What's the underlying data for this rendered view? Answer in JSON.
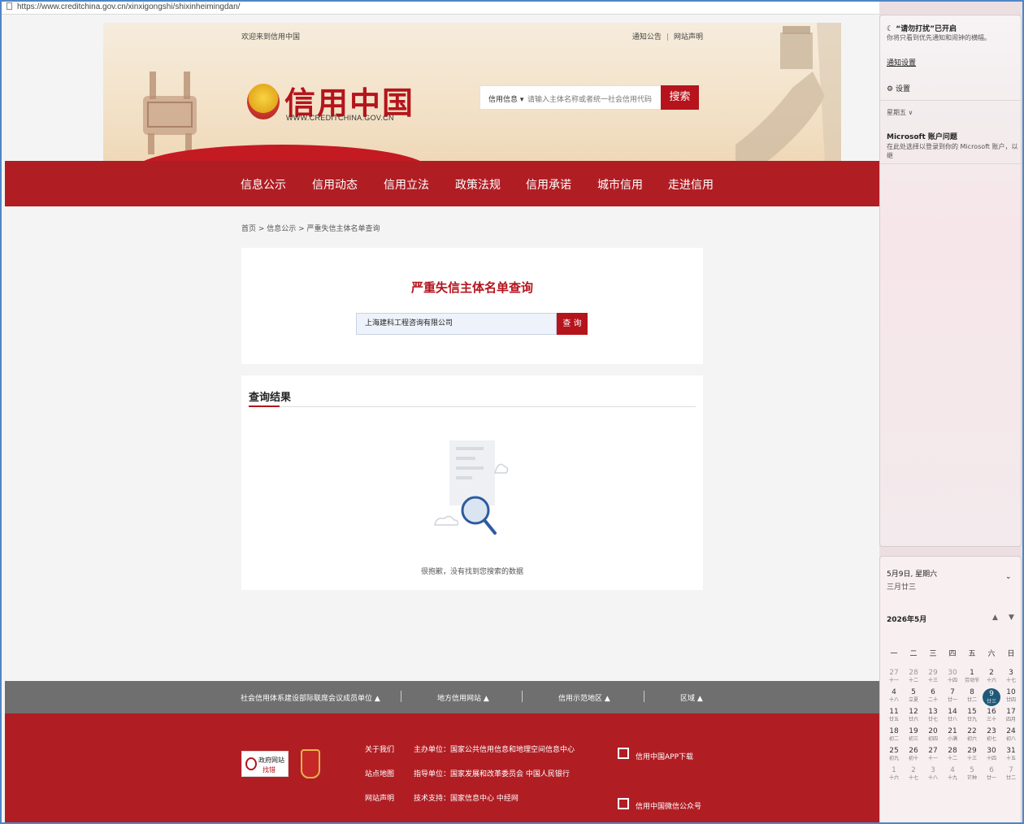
{
  "browser": {
    "url": "https://www.creditchina.gov.cn/xinxigongshi/shixinheimingdan/"
  },
  "header": {
    "welcome": "欢迎来到信用中国",
    "links": [
      "通知公告",
      "网站声明"
    ],
    "brand": "信用中国",
    "brand_sub": "WWW.CREDITCHINA.GOV.CN",
    "search_scope": "信用信息",
    "search_placeholder": "请输入主体名称或者统一社会信用代码",
    "search_button": "搜索"
  },
  "nav": [
    "信息公示",
    "信用动态",
    "信用立法",
    "政策法规",
    "信用承诺",
    "城市信用",
    "走进信用"
  ],
  "breadcrumb": "首页 > 信息公示 > 严重失信主体名单查询",
  "query": {
    "title": "严重失信主体名单查询",
    "input_value": "上海建科工程咨询有限公司",
    "button": "查 询"
  },
  "results": {
    "title": "查询结果",
    "empty_message": "很抱歉，没有找到您搜索的数据"
  },
  "greybar": [
    "社会信用体系建设部际联席会议成员单位 ▲",
    "地方信用网站 ▲",
    "信用示范地区 ▲",
    "区域 ▲"
  ],
  "footer": {
    "links": [
      "关于我们",
      "站点地图",
      "网站声明"
    ],
    "sponsor": "主办单位：国家公共信用信息和地理空间信息中心",
    "guide": "指导单位：国家发展和改革委员会 中国人民银行",
    "support": "技术支持：国家信息中心 中经网",
    "app": "信用中国APP下载",
    "wechat": "信用中国微信公众号",
    "gov_badge_1": "政府网站",
    "gov_badge_2": "找错"
  },
  "notification_panel": {
    "dnd_title": "“请勿打扰”已开启",
    "dnd_desc": "你将只看到优先通知和闹钟的横幅。",
    "notif_settings": "通知设置",
    "settings": "设置",
    "group": "星期五 ∨",
    "ms_title": "Microsoft 账户问题",
    "ms_desc": "在此处选择以登录到你的 Microsoft 账户，以继"
  },
  "calendar": {
    "date_line": "5月9日, 星期六",
    "lunar_line": "三月廿三",
    "month": "2026年5月",
    "weekdays": [
      "一",
      "二",
      "三",
      "四",
      "五",
      "六",
      "日"
    ],
    "rows": [
      [
        [
          "27",
          "十一"
        ],
        [
          "28",
          "十二"
        ],
        [
          "29",
          "十三"
        ],
        [
          "30",
          "十四"
        ],
        [
          "1",
          "劳动节"
        ],
        [
          "2",
          "十六"
        ],
        [
          "3",
          "十七"
        ]
      ],
      [
        [
          "4",
          "十八"
        ],
        [
          "5",
          "立夏"
        ],
        [
          "6",
          "二十"
        ],
        [
          "7",
          "廿一"
        ],
        [
          "8",
          "廿二"
        ],
        [
          "9",
          "廿三"
        ],
        [
          "10",
          "廿四"
        ]
      ],
      [
        [
          "11",
          "廿五"
        ],
        [
          "12",
          "廿六"
        ],
        [
          "13",
          "廿七"
        ],
        [
          "14",
          "廿八"
        ],
        [
          "15",
          "廿九"
        ],
        [
          "16",
          "三十"
        ],
        [
          "17",
          "四月"
        ]
      ],
      [
        [
          "18",
          "初二"
        ],
        [
          "19",
          "初三"
        ],
        [
          "20",
          "初四"
        ],
        [
          "21",
          "小满"
        ],
        [
          "22",
          "初六"
        ],
        [
          "23",
          "初七"
        ],
        [
          "24",
          "初八"
        ]
      ],
      [
        [
          "25",
          "初九"
        ],
        [
          "26",
          "初十"
        ],
        [
          "27",
          "十一"
        ],
        [
          "28",
          "十二"
        ],
        [
          "29",
          "十三"
        ],
        [
          "30",
          "十四"
        ],
        [
          "31",
          "十五"
        ]
      ],
      [
        [
          "1",
          "十六"
        ],
        [
          "2",
          "十七"
        ],
        [
          "3",
          "十八"
        ],
        [
          "4",
          "十九"
        ],
        [
          "5",
          "芒种"
        ],
        [
          "6",
          "廿一"
        ],
        [
          "7",
          "廿二"
        ]
      ]
    ],
    "today": "9"
  }
}
